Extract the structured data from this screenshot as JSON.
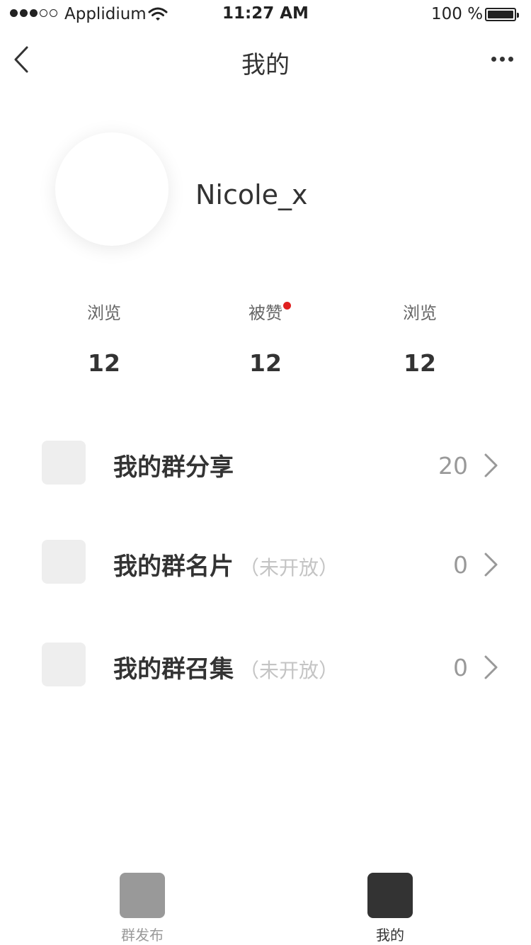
{
  "status_bar": {
    "carrier": "Applidium",
    "time": "11:27 AM",
    "battery_percent": "100 %",
    "signal_full": 3,
    "signal_empty": 2
  },
  "nav": {
    "title": "我的",
    "back_icon": "chevron-left-icon",
    "more_icon": "more-icon"
  },
  "profile": {
    "username": "Nicole_x"
  },
  "stats": [
    {
      "label": "浏览",
      "value": "12",
      "has_badge": false
    },
    {
      "label": "被赞",
      "value": "12",
      "has_badge": true
    },
    {
      "label": "浏览",
      "value": "12",
      "has_badge": false
    }
  ],
  "menu": [
    {
      "title": "我的群分享",
      "note": "",
      "count": "20"
    },
    {
      "title": "我的群名片",
      "note": "（未开放）",
      "count": "0"
    },
    {
      "title": "我的群召集",
      "note": "（未开放）",
      "count": "0"
    }
  ],
  "tabbar": [
    {
      "label": "群发布",
      "active": false
    },
    {
      "label": "我的",
      "active": true
    }
  ],
  "colors": {
    "badge": "#e02020",
    "tab_inactive": "#999999",
    "tab_active": "#333333",
    "placeholder": "#eeeeee"
  }
}
